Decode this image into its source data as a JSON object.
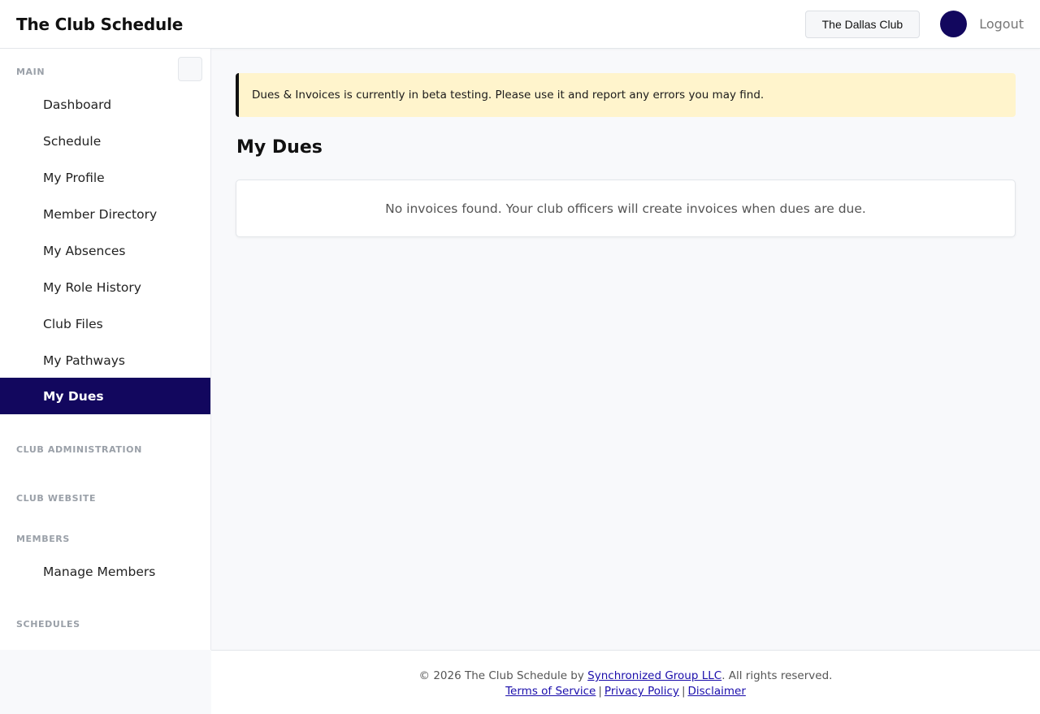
{
  "header": {
    "brand": "The Club Schedule",
    "club_button": "The Dallas Club",
    "logout": "Logout"
  },
  "sidebar": {
    "sections": {
      "main": "MAIN",
      "club_admin": "CLUB ADMINISTRATION",
      "club_website": "CLUB WEBSITE",
      "members": "MEMBERS",
      "schedules": "SCHEDULES"
    },
    "main_items": [
      "Dashboard",
      "Schedule",
      "My Profile",
      "Member Directory",
      "My Absences",
      "My Role History",
      "Club Files",
      "My Pathways",
      "My Dues"
    ],
    "members_items": [
      "Manage Members"
    ]
  },
  "main": {
    "alert": "Dues & Invoices is currently in beta testing. Please use it and report any errors you may find.",
    "title": "My Dues",
    "empty_message": "No invoices found. Your club officers will create invoices when dues are due."
  },
  "footer": {
    "prefix": "© 2026 The Club Schedule by ",
    "company": "Synchronized Group LLC",
    "suffix": ". All rights reserved.",
    "links": [
      "Terms of Service",
      "Privacy Policy",
      "Disclaimer"
    ],
    "separator": "|"
  },
  "colors": {
    "accent": "#12075e",
    "alert_bg": "#fff4cc",
    "link": "#1a0dab"
  }
}
